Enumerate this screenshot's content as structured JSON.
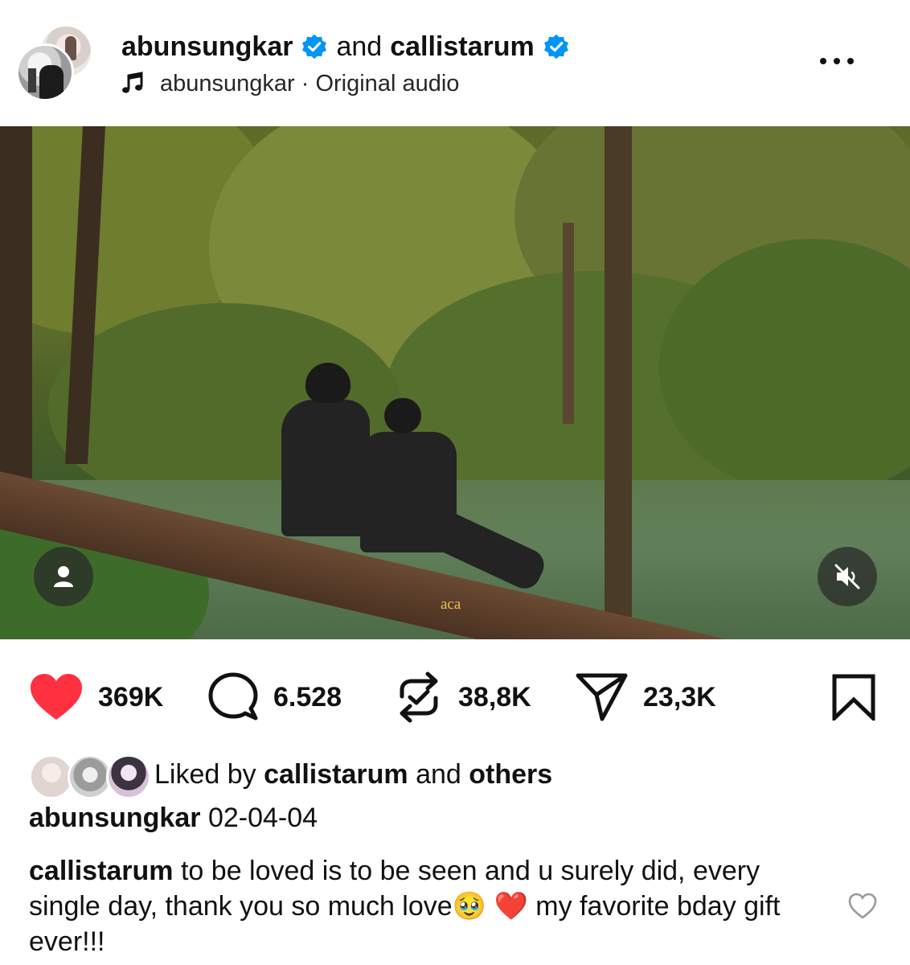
{
  "post": {
    "author": "abunsungkar",
    "and_text": "and",
    "collaborator": "callistarum",
    "audio_label": "abunsungkar · Original audio",
    "media_caption": "aca"
  },
  "actions": {
    "likes": "369K",
    "comments": "6.528",
    "reposts": "38,8K",
    "shares": "23,3K"
  },
  "liked_by": {
    "prefix": "Liked by",
    "user": "callistarum",
    "and_text": "and",
    "others": "others"
  },
  "caption": {
    "user": "abunsungkar",
    "text": "02-04-04"
  },
  "comment": {
    "user": "callistarum",
    "text_before_emoji": "to be loved is to be seen and u surely did, every single day, thank you so much love",
    "emoji_1": "🥹",
    "emoji_2": "❤️",
    "text_after_emoji": "my favorite bday gift ever!!!"
  },
  "icons": {
    "verified": "verified-badge-icon",
    "audio": "music-note-icon",
    "more": "more-options-icon",
    "tag": "tagged-user-icon",
    "mute": "muted-speaker-icon",
    "like": "heart-icon",
    "comment": "comment-bubble-icon",
    "repost": "repost-icon",
    "share": "send-icon",
    "save": "bookmark-icon",
    "comment_like": "heart-outline-icon"
  },
  "colors": {
    "like_red": "#ff3040",
    "verified_blue": "#0095f6",
    "text": "#111111",
    "watermark": "#e6c25a"
  }
}
